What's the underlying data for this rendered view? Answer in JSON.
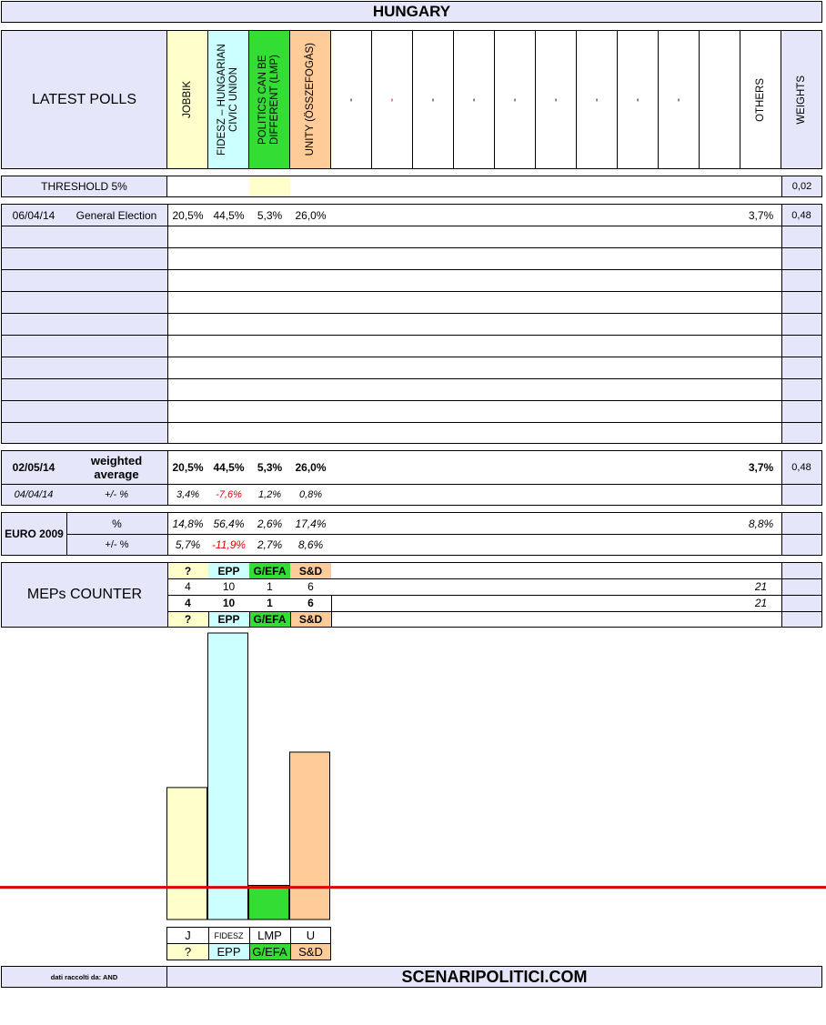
{
  "title": "HUNGARY",
  "header": {
    "latest_polls": "LATEST POLLS",
    "parties": [
      "JOBBIK",
      "FIDESZ – HUNGARIAN CIVIC UNION",
      "POLITICS CAN BE DIFFERENT (LMP)",
      "UNITY (ÖSSZEFOGÁS)",
      "-",
      "-",
      "-",
      "-",
      "-",
      "-",
      "-",
      "-",
      "-"
    ],
    "others": "OTHERS",
    "weights": "WEIGHTS"
  },
  "threshold": {
    "label": "THRESHOLD 5%",
    "weight": "0,02"
  },
  "poll": {
    "date": "06/04/14",
    "name": "General Election",
    "values": [
      "20,5%",
      "44,5%",
      "5,3%",
      "26,0%"
    ],
    "others": "3,7%",
    "weight": "0,48"
  },
  "weighted": {
    "date": "02/05/14",
    "label": "weighted average",
    "values": [
      "20,5%",
      "44,5%",
      "5,3%",
      "26,0%"
    ],
    "others": "3,7%",
    "weight": "0,48",
    "diff_date": "04/04/14",
    "diff_label": "+/- %",
    "diffs": [
      "3,4%",
      "-7,6%",
      "1,2%",
      "0,8%"
    ]
  },
  "euro": {
    "label": "EURO 2009",
    "pct_label": "%",
    "diff_label": "+/- %",
    "values": [
      "14,8%",
      "56,4%",
      "2,6%",
      "17,4%"
    ],
    "others": "8,8%",
    "diffs": [
      "5,7%",
      "-11,9%",
      "2,7%",
      "8,6%"
    ]
  },
  "meps": {
    "label": "MEPs COUNTER",
    "groups": [
      "?",
      "EPP",
      "G/EFA",
      "S&D"
    ],
    "row1": [
      "4",
      "10",
      "1",
      "6"
    ],
    "total1": "21",
    "row2": [
      "4",
      "10",
      "1",
      "6"
    ],
    "total2": "21"
  },
  "chart_data": {
    "type": "bar",
    "categories": [
      "J",
      "FIDESZ",
      "LMP",
      "U"
    ],
    "groups": [
      "?",
      "EPP",
      "G/EFA",
      "S&D"
    ],
    "values": [
      20.5,
      44.5,
      5.3,
      26.0
    ],
    "threshold": 5,
    "colors": [
      "#ffffcc",
      "#ccffff",
      "#33dd33",
      "#ffcc99"
    ],
    "threshold_color": "#e00000"
  },
  "footer": {
    "source": "dati raccolti da: AND",
    "site": "SCENARIPOLITICI.COM"
  }
}
